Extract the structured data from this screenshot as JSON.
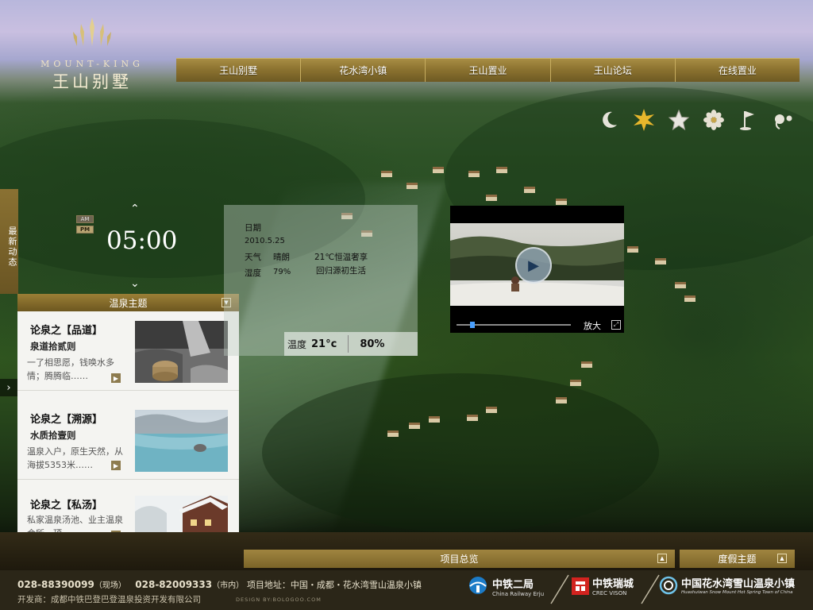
{
  "logo": {
    "en": "MOUNT-KING",
    "cn": "王山别墅"
  },
  "nav": [
    "王山别墅",
    "花水湾小镇",
    "王山置业",
    "王山论坛",
    "在线置业"
  ],
  "icons": [
    {
      "name": "moon-icon",
      "glyph": "☾"
    },
    {
      "name": "sun-icon",
      "glyph": "✹"
    },
    {
      "name": "star-icon",
      "glyph": "★"
    },
    {
      "name": "flower-icon",
      "glyph": "❀"
    },
    {
      "name": "flag-icon",
      "glyph": "⚑"
    },
    {
      "name": "dots-icon",
      "glyph": "•"
    }
  ],
  "news_tab": "最新动态",
  "clock": {
    "am": "AM",
    "pm": "PM",
    "time": "05:00"
  },
  "themes": {
    "title": "温泉主题",
    "items": [
      {
        "title": "论泉之【品道】",
        "subtitle": "泉道拾贰则",
        "desc": "一了相思愿，钱唤水多情；腾腾临……"
      },
      {
        "title": "论泉之【溯源】",
        "subtitle": "水质拾壹则",
        "desc": "温泉入户，原生天然，从海拔5353米……"
      },
      {
        "title": "论泉之【私汤】",
        "subtitle": "",
        "desc": "私家温泉汤池、业主温泉会所、顶……"
      }
    ]
  },
  "weather": {
    "date_label": "日期",
    "date": "2010.5.25",
    "weather_label": "天气",
    "weather_value": "晴朗",
    "humidity_label": "湿度",
    "humidity_value": "79%",
    "slogan1": "21℃恒温奢享",
    "slogan2": "回归源初生活",
    "temp_label": "温度",
    "temp_value": "21°c",
    "percent": "80%"
  },
  "video": {
    "zoom_label": "放大"
  },
  "bottom": {
    "overview": "项目总览",
    "holiday": "度假主题"
  },
  "footer": {
    "phone1": "028-88390099",
    "phone1_tag": "（现场）",
    "phone2": "028-82009333",
    "phone2_tag": "（市内）",
    "address": "项目地址：中国・成都・花水湾雪山温泉小镇",
    "developer": "开发商：成都中铁巴登巴登温泉投资开发有限公司",
    "design": "DESIGN BY:BOLOGOO.COM",
    "partner1": "中铁二局",
    "partner1_sub": "China Railway Erju",
    "partner2": "中铁瑞城",
    "partner2_sub": "CREC VISON",
    "partner3": "中国花水湾雪山温泉小镇",
    "partner3_sub": "Huashuiwan Snow Mount Hot Spring Town of China"
  },
  "colors": {
    "gold": "#8c7330",
    "footer": "#2b2618",
    "accent": "#4aa0ff"
  }
}
